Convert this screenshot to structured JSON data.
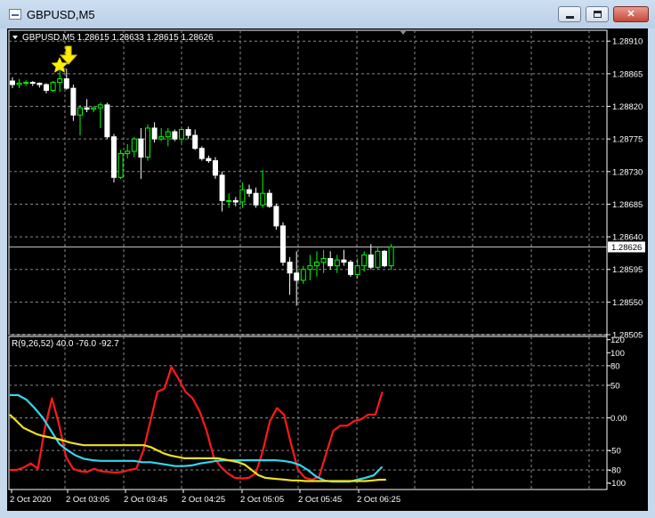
{
  "window": {
    "title": "GBPUSD,M5",
    "icon": "chart-window-icon",
    "buttons": {
      "minimize_icon": "minimize-icon",
      "maximize_icon": "maximize-icon",
      "close_label": "✕"
    }
  },
  "main_chart": {
    "header": "GBPUSD,M5  1.28615 1.28633 1.28615 1.28626",
    "price_labels": [
      "1.28910",
      "1.28865",
      "1.28820",
      "1.28775",
      "1.28730",
      "1.28685",
      "1.28640",
      "1.28595",
      "1.28550",
      "1.28505"
    ],
    "current_price": "1.28626",
    "colors": {
      "bull": "#00ff00",
      "bear": "#ffffff",
      "signal_arrow": "#ffee00",
      "price_line": "#c0c0c0"
    }
  },
  "indicator": {
    "header": "R(9,26,52) 40.0 -76.0 -92.7",
    "levels": [
      "120",
      "100",
      "80",
      "50",
      "0.00",
      "-50",
      "-80",
      "-100"
    ],
    "colors": {
      "line1": "#ff1a1a",
      "line2": "#33d6f0",
      "line3": "#f0e020"
    }
  },
  "time_labels": [
    "2 Oct 2020",
    "2 Oct 03:05",
    "2 Oct 03:45",
    "2 Oct 04:25",
    "2 Oct 05:05",
    "2 Oct 05:45",
    "2 Oct 06:25"
  ],
  "chart_data": {
    "type": "candlestick",
    "symbol": "GBPUSD",
    "timeframe": "M5",
    "y_range": [
      1.28505,
      1.28925
    ],
    "candles": [
      [
        1.28855,
        1.2886,
        1.28845,
        1.2885
      ],
      [
        1.2885,
        1.28858,
        1.28845,
        1.28852
      ],
      [
        1.28852,
        1.28856,
        1.28848,
        1.28853
      ],
      [
        1.28853,
        1.28855,
        1.28848,
        1.28852
      ],
      [
        1.28852,
        1.28853,
        1.28846,
        1.2885
      ],
      [
        1.2885,
        1.28852,
        1.28838,
        1.28842
      ],
      [
        1.28842,
        1.28855,
        1.2884,
        1.28853
      ],
      [
        1.28853,
        1.2887,
        1.2884,
        1.28858
      ],
      [
        1.28858,
        1.28872,
        1.28843,
        1.28845
      ],
      [
        1.28845,
        1.2885,
        1.288,
        1.28808
      ],
      [
        1.28808,
        1.28822,
        1.2878,
        1.28818
      ],
      [
        1.28818,
        1.2883,
        1.28812,
        1.28816
      ],
      [
        1.28816,
        1.2882,
        1.28812,
        1.28818
      ],
      [
        1.28818,
        1.28825,
        1.2879,
        1.28822
      ],
      [
        1.28822,
        1.28825,
        1.28775,
        1.28778
      ],
      [
        1.28778,
        1.28782,
        1.28715,
        1.28722
      ],
      [
        1.28722,
        1.2876,
        1.2872,
        1.28755
      ],
      [
        1.28755,
        1.28768,
        1.28748,
        1.28758
      ],
      [
        1.28758,
        1.28778,
        1.2875,
        1.28775
      ],
      [
        1.28775,
        1.2879,
        1.2872,
        1.2875
      ],
      [
        1.2875,
        1.28795,
        1.28745,
        1.2879
      ],
      [
        1.2879,
        1.28798,
        1.2877,
        1.28775
      ],
      [
        1.28775,
        1.2879,
        1.28772,
        1.28778
      ],
      [
        1.28778,
        1.2879,
        1.28765,
        1.28785
      ],
      [
        1.28785,
        1.28788,
        1.28772,
        1.28775
      ],
      [
        1.28775,
        1.2879,
        1.2877,
        1.28788
      ],
      [
        1.28788,
        1.28792,
        1.28775,
        1.2878
      ],
      [
        1.2878,
        1.28788,
        1.2876,
        1.28762
      ],
      [
        1.28762,
        1.28765,
        1.28745,
        1.28748
      ],
      [
        1.28748,
        1.28752,
        1.28742,
        1.28745
      ],
      [
        1.28745,
        1.2875,
        1.2872,
        1.28725
      ],
      [
        1.28725,
        1.2873,
        1.28675,
        1.2869
      ],
      [
        1.2869,
        1.287,
        1.2868,
        1.2869
      ],
      [
        1.2869,
        1.28695,
        1.28682,
        1.28688
      ],
      [
        1.28688,
        1.28715,
        1.2868,
        1.28705
      ],
      [
        1.28705,
        1.28712,
        1.28695,
        1.287
      ],
      [
        1.287,
        1.28708,
        1.2868,
        1.28684
      ],
      [
        1.28684,
        1.28732,
        1.2868,
        1.287
      ],
      [
        1.287,
        1.28705,
        1.2868,
        1.28682
      ],
      [
        1.28682,
        1.28686,
        1.2865,
        1.28655
      ],
      [
        1.28655,
        1.2866,
        1.286,
        1.28605
      ],
      [
        1.28605,
        1.28612,
        1.2856,
        1.2859
      ],
      [
        1.2859,
        1.2862,
        1.28545,
        1.2858
      ],
      [
        1.2858,
        1.286,
        1.28575,
        1.28595
      ],
      [
        1.28595,
        1.28615,
        1.2858,
        1.286
      ],
      [
        1.286,
        1.2862,
        1.28585,
        1.28605
      ],
      [
        1.28605,
        1.28622,
        1.2859,
        1.2861
      ],
      [
        1.2861,
        1.2862,
        1.28595,
        1.286
      ],
      [
        1.286,
        1.28615,
        1.2859,
        1.28608
      ],
      [
        1.28608,
        1.28622,
        1.286,
        1.28605
      ],
      [
        1.28605,
        1.28608,
        1.28585,
        1.28588
      ],
      [
        1.28588,
        1.2861,
        1.28582,
        1.286
      ],
      [
        1.286,
        1.2862,
        1.28592,
        1.28615
      ],
      [
        1.28615,
        1.2863,
        1.28595,
        1.28598
      ],
      [
        1.28598,
        1.28625,
        1.28595,
        1.2862
      ],
      [
        1.2862,
        1.28622,
        1.28598,
        1.286
      ],
      [
        1.286,
        1.2863,
        1.28595,
        1.28626
      ]
    ],
    "indicator": {
      "name": "R(9,26,52)",
      "y_range": [
        -110,
        125
      ],
      "series": [
        {
          "name": "",
          "values": [
            -80,
            -80,
            -76,
            -70,
            -78,
            -15,
            30,
            -10,
            -60,
            -78,
            -82,
            -83,
            -78,
            -82,
            -83,
            -84,
            -83,
            -80,
            -78,
            -50,
            -5,
            40,
            45,
            78,
            60,
            40,
            30,
            10,
            -20,
            -60,
            -75,
            -85,
            -92,
            -93,
            -92,
            -85,
            -50,
            -5,
            15,
            5,
            -40,
            -80,
            -92,
            -95,
            -90,
            -55,
            -20,
            -12,
            -12,
            -5,
            -2,
            5,
            5,
            40
          ]
        },
        {
          "name": "",
          "values": [
            35,
            35,
            28,
            15,
            0,
            -20,
            -40,
            -50,
            -58,
            -63,
            -65,
            -66,
            -66,
            -66,
            -66,
            -66,
            -68,
            -68,
            -70,
            -72,
            -74,
            -74,
            -73,
            -70,
            -68,
            -66,
            -65,
            -65,
            -65,
            -65,
            -65,
            -65,
            -65,
            -66,
            -68,
            -72,
            -80,
            -90,
            -96,
            -98,
            -98,
            -98,
            -95,
            -92,
            -88,
            -75
          ]
        },
        {
          "name": "",
          "values": [
            5,
            -5,
            -15,
            -20,
            -25,
            -28,
            -30,
            -32,
            -35,
            -38,
            -40,
            -42,
            -42,
            -42,
            -42,
            -42,
            -42,
            -42,
            -42,
            -42,
            -42,
            -45,
            -50,
            -55,
            -58,
            -60,
            -62,
            -62,
            -62,
            -62,
            -62,
            -62,
            -64,
            -66,
            -68,
            -72,
            -80,
            -88,
            -92,
            -93,
            -94,
            -95,
            -96,
            -96,
            -97,
            -97,
            -97,
            -97,
            -97,
            -97,
            -97,
            -97,
            -97,
            -97,
            -96,
            -95,
            -95
          ]
        }
      ]
    }
  }
}
